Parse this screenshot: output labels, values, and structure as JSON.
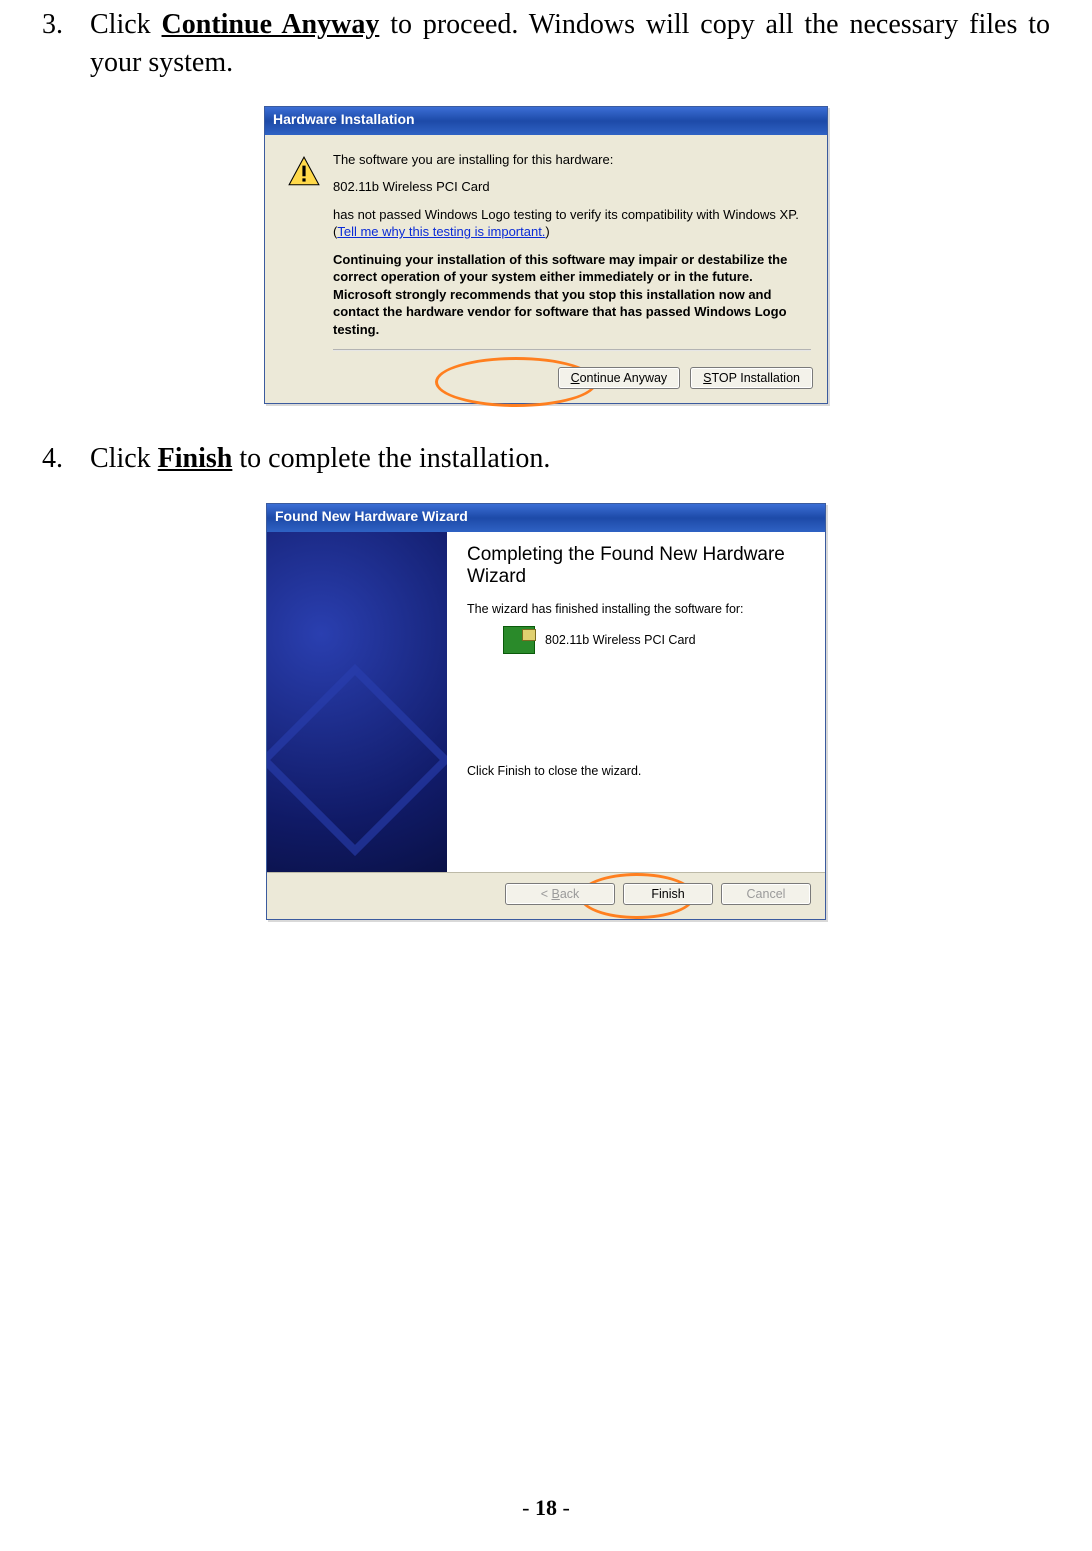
{
  "step3": {
    "num": "3.",
    "text_before": "Click ",
    "action": "Continue Anyway",
    "text_after": " to proceed. Windows will copy all the necessary files to your system."
  },
  "dlg1": {
    "title": "Hardware Installation",
    "line1": "The software you are installing for this hardware:",
    "device": "802.11b Wireless PCI Card",
    "line2a": "has not passed Windows Logo testing to verify its compatibility with Windows XP. (",
    "link": "Tell me why this testing is important.",
    "line2b": ")",
    "warn": "Continuing your installation of this software may impair or destabilize the correct operation of your system either immediately or in the future. Microsoft strongly recommends that you stop this installation now and contact the hardware vendor for software that has passed Windows Logo testing.",
    "btn_continue_u": "C",
    "btn_continue_rest": "ontinue Anyway",
    "btn_stop_u": "S",
    "btn_stop_rest": "TOP Installation"
  },
  "step4": {
    "num": "4.",
    "text_before": "Click ",
    "action": "Finish",
    "text_after": " to complete the installation."
  },
  "dlg2": {
    "title": "Found New Hardware Wizard",
    "heading": "Completing the Found New Hardware Wizard",
    "line1": "The wizard has finished installing the software for:",
    "device": "802.11b Wireless PCI Card",
    "line2": "Click Finish to close the wizard.",
    "btn_back_lt": "< ",
    "btn_back_u": "B",
    "btn_back_rest": "ack",
    "btn_finish": "Finish",
    "btn_cancel": "Cancel"
  },
  "pagenum": {
    "dash1": "- ",
    "num": "18",
    "dash2": " -"
  }
}
